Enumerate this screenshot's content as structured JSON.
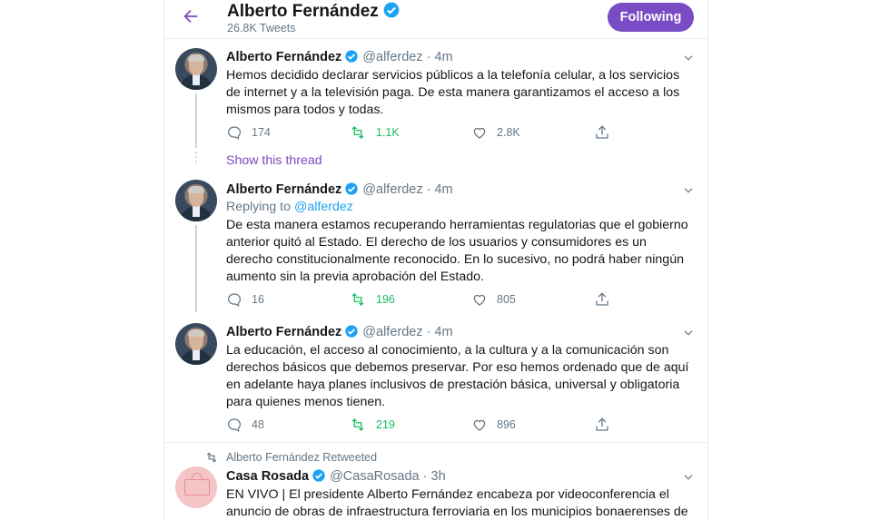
{
  "header": {
    "name": "Alberto Fernández",
    "tweet_count": "26.8K Tweets",
    "follow_label": "Following"
  },
  "tweets": [
    {
      "name": "Alberto Fernández",
      "handle": "@alferdez",
      "time": "· 4m",
      "text": "Hemos decidido declarar servicios públicos a la telefonía celular, a los servicios de internet y a la televisión paga. De esta manera garantizamos el acceso a los mismos para todos y todas.",
      "replies": "174",
      "retweets": "1.1K",
      "likes": "2.8K"
    },
    {
      "name": "Alberto Fernández",
      "handle": "@alferdez",
      "time": "· 4m",
      "replying_prefix": "Replying to",
      "replying_handle": "@alferdez",
      "text": "De esta manera estamos recuperando herramientas regulatorias que el gobierno anterior quitó al Estado. El derecho de los usuarios y consumidores es un derecho constitucionalmente reconocido. En lo sucesivo, no podrá haber ningún aumento sin la previa aprobación del Estado.",
      "replies": "16",
      "retweets": "196",
      "likes": "805"
    },
    {
      "name": "Alberto Fernández",
      "handle": "@alferdez",
      "time": "· 4m",
      "text": "La educación, el acceso al conocimiento, a la cultura y a la comunicación son derechos básicos que debemos preservar. Por eso hemos ordenado que de aquí en adelante haya planes inclusivos de prestación básica, universal y obligatoria para quienes menos tienen.",
      "replies": "48",
      "retweets": "219",
      "likes": "896"
    },
    {
      "retweeted_by": "Alberto Fernández Retweeted",
      "name": "Casa Rosada",
      "handle": "@CasaRosada",
      "time": "· 3h",
      "text": "EN VIVO | El presidente Alberto Fernández encabeza por videoconferencia el anuncio de obras de infraestructura ferroviaria en los municipios bonaerenses de"
    }
  ],
  "show_thread": "Show this thread",
  "colors": {
    "accent": "#794bc4",
    "link": "#1da1f2",
    "retweet": "#17bf63",
    "muted": "#657786"
  }
}
